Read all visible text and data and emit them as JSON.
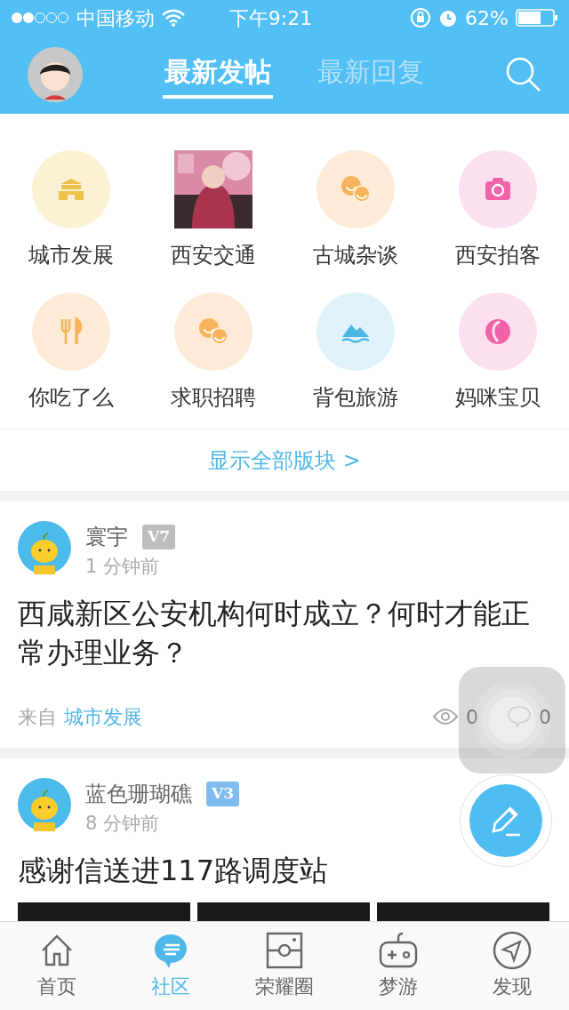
{
  "status_bar": {
    "carrier": "中国移动",
    "time": "下午9:21",
    "battery": "62%"
  },
  "header": {
    "tabs": [
      {
        "label": "最新发帖",
        "selected": true
      },
      {
        "label": "最新回复",
        "selected": false
      }
    ]
  },
  "categories": [
    {
      "label": "城市发展",
      "kind": "icon",
      "color": "#fdf1d3"
    },
    {
      "label": "西安交通",
      "kind": "picture"
    },
    {
      "label": "古城杂谈",
      "kind": "icon",
      "color": "#fdebd8"
    },
    {
      "label": "西安拍客",
      "kind": "icon",
      "color": "#fde0ef"
    },
    {
      "label": "你吃了么",
      "kind": "icon",
      "color": "#fdebd8"
    },
    {
      "label": "求职招聘",
      "kind": "icon",
      "color": "#fdebd8"
    },
    {
      "label": "背包旅游",
      "kind": "icon",
      "color": "#dff2fb"
    },
    {
      "label": "妈咪宝贝",
      "kind": "icon",
      "color": "#fde0ef"
    }
  ],
  "show_all": "显示全部版块 >",
  "posts": [
    {
      "author": "寰宇",
      "level": "V7",
      "color": "#bdbdbd",
      "time": "1 分钟前",
      "title": "西咸新区公安机构何时成立？何时才能正常办理业务？",
      "source_label": "来自",
      "source": "城市发展",
      "views": "0",
      "comments": "0"
    },
    {
      "author": "蓝色珊瑚礁",
      "level": "V3",
      "color": "#7fbdf0",
      "time": "8 分钟前",
      "title": "感谢信送进117路调度站"
    }
  ],
  "tab_bar": [
    {
      "label": "首页",
      "selected": false
    },
    {
      "label": "社区",
      "selected": true
    },
    {
      "label": "荣耀圈",
      "selected": false
    },
    {
      "label": "梦游",
      "selected": false
    },
    {
      "label": "发现",
      "selected": false
    }
  ]
}
